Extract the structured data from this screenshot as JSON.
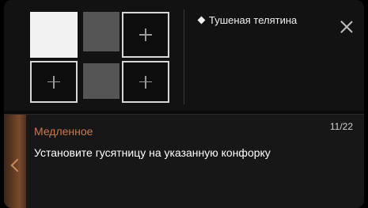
{
  "header": {
    "dish_name": "Тушеная телятина"
  },
  "cooktop": {
    "burners": [
      {
        "id": "top-left",
        "state": "active"
      },
      {
        "id": "top-middle",
        "state": "inactive"
      },
      {
        "id": "top-right",
        "state": "empty",
        "icon": "plus-icon"
      },
      {
        "id": "bottom-left",
        "state": "empty",
        "icon": "plus-icon"
      },
      {
        "id": "bottom-middle",
        "state": "inactive"
      },
      {
        "id": "bottom-right",
        "state": "empty",
        "icon": "plus-icon"
      }
    ]
  },
  "step": {
    "title": "Медленное",
    "counter": "11/22",
    "instruction": "Установите гусятницу на указанную конфорку"
  },
  "icons": {
    "close": "close-icon",
    "back": "chevron-left-icon",
    "bullet": "diamond-icon"
  },
  "colors": {
    "accent": "#c87a4c",
    "burner_active": "#f2f2f2",
    "burner_inactive": "#555555"
  }
}
